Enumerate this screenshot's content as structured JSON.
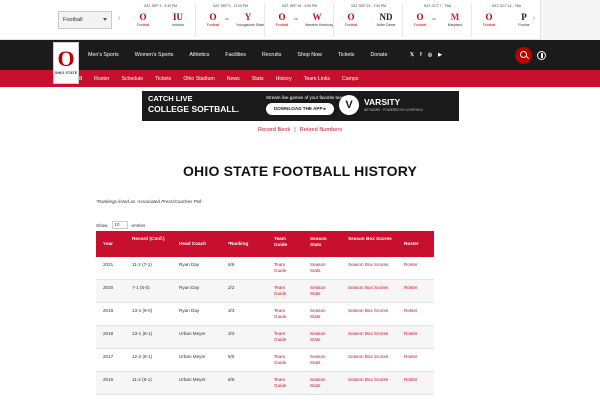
{
  "schedule": {
    "sport_value": "Football",
    "prev_arrow": "‹",
    "next_arrow": "›",
    "games": [
      {
        "date": "SAT, SEP 2 - 3:30 PM",
        "home": "Football",
        "vs": "",
        "opponent": "Indiana",
        "opp_mark": "IU",
        "opp_color": "#990000"
      },
      {
        "date": "SAT, SEP 9 - 12:00 PM",
        "home": "Football",
        "vs": "vs.",
        "opponent": "Youngstown State",
        "opp_mark": "Y",
        "opp_color": "#c8102e"
      },
      {
        "date": "SAT, SEP 16 - 4:00 PM",
        "home": "Football",
        "vs": "vs.",
        "opponent": "Western Kentucky",
        "opp_mark": "W",
        "opp_color": "#c8102e"
      },
      {
        "date": "SAT, SEP 23 - 7:30 PM",
        "home": "Football",
        "vs": "",
        "opponent": "Notre Dame",
        "opp_mark": "ND",
        "opp_color": "#0c2340"
      },
      {
        "date": "SAT, OCT 7 - TBA",
        "home": "Football",
        "vs": "vs.",
        "opponent": "Maryland",
        "opp_mark": "M",
        "opp_color": "#e21833"
      },
      {
        "date": "SAT, OCT 14 - TBA",
        "home": "Football",
        "vs": "",
        "opponent": "Purdue",
        "opp_mark": "P",
        "opp_color": "#1a1a1a"
      }
    ]
  },
  "logo": {
    "mark": "O",
    "word": "OHIO STATE"
  },
  "nav": {
    "items": [
      "Men's Sports",
      "Women's Sports",
      "Athletics",
      "Facilities",
      "Recruits",
      "Shop Now",
      "Tickets",
      "Donate"
    ],
    "social": [
      "𝕏",
      "f",
      "◎",
      "▶"
    ]
  },
  "subnav": {
    "items": [
      "Football",
      "Roster",
      "Schedule",
      "Tickets",
      "Ohio Stadium",
      "News",
      "Stats",
      "History",
      "Team Links",
      "Camps"
    ]
  },
  "banner": {
    "line1": "CATCH LIVE",
    "line2": "COLLEGE SOFTBALL.",
    "tagline": "Stream live games of your favorite teams.",
    "cta": "DOWNLOAD THE APP ▸",
    "mark": "V",
    "brand": "VARSITY",
    "brand_sub": "NETWORK · POWERED BY LEARFIELD"
  },
  "records": {
    "record_book": "Record Book",
    "sep": "|",
    "retired": "Retired Numbers"
  },
  "page": {
    "title": "OHIO STATE FOOTBALL HISTORY",
    "note": "*Rankings listed as: Associated Press/Coaches Poll"
  },
  "show": {
    "label": "Show",
    "value": "10",
    "suffix": "entries"
  },
  "table": {
    "headers": {
      "year": "Year",
      "record": "Record (Conf.)",
      "coach": "Head Coach",
      "ranking": "*Ranking",
      "guide": "Team Guide",
      "stats": "Season Stats",
      "box": "Season Box Scores",
      "roster": "Roster"
    },
    "rows": [
      {
        "year": "2021",
        "record": "11-2 (7-1)",
        "coach": "Ryan Day",
        "ranking": "6/6",
        "guide": "Team Guide",
        "stats": "Season Stats",
        "box": "Season Box Scores",
        "roster": "Roster"
      },
      {
        "year": "2020",
        "record": "7-1 (5-0)",
        "coach": "Ryan Day",
        "ranking": "2/2",
        "guide": "Team Guide",
        "stats": "Season Stats",
        "box": "Season Box Scores",
        "roster": "Roster"
      },
      {
        "year": "2019",
        "record": "13-1 (9-0)",
        "coach": "Ryan Day",
        "ranking": "3/3",
        "guide": "Team Guide",
        "stats": "Season Stats",
        "box": "Season Box Scores",
        "roster": "Roster"
      },
      {
        "year": "2018",
        "record": "13-1 (8-1)",
        "coach": "Urban Meyer",
        "ranking": "3/3",
        "guide": "Team Guide",
        "stats": "Season Stats",
        "box": "Season Box Scores",
        "roster": "Roster"
      },
      {
        "year": "2017",
        "record": "12-2 (8-1)",
        "coach": "Urban Meyer",
        "ranking": "5/5",
        "guide": "Team Guide",
        "stats": "Season Stats",
        "box": "Season Box Scores",
        "roster": "Roster"
      },
      {
        "year": "2016",
        "record": "11-2 (8-1)",
        "coach": "Urban Meyer",
        "ranking": "6/6",
        "guide": "Team Guide",
        "stats": "Season Stats",
        "box": "Season Box Scores",
        "roster": "Roster"
      }
    ]
  }
}
